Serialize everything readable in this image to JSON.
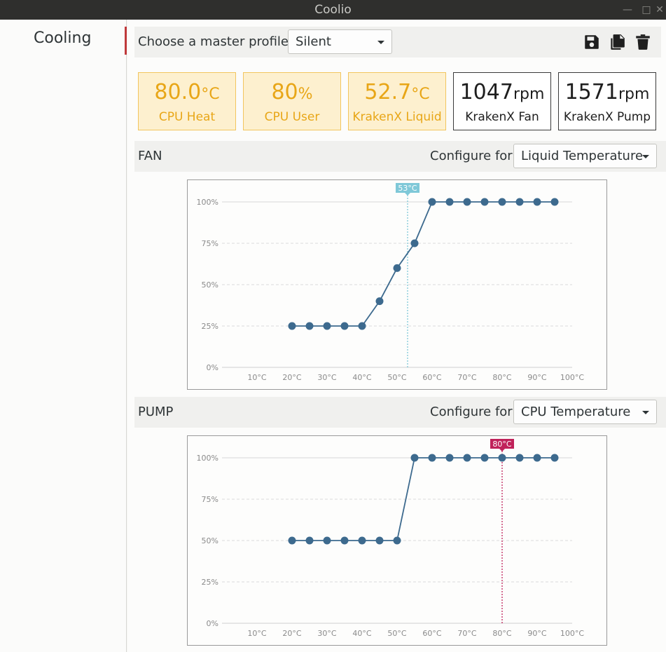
{
  "window": {
    "title": "Coolio"
  },
  "sidebar": {
    "items": [
      {
        "label": "Cooling",
        "selected": true
      }
    ]
  },
  "profile": {
    "label": "Choose a master profile:",
    "selected": "Silent",
    "tools": [
      "save-icon",
      "copy-icon",
      "delete-icon"
    ]
  },
  "cards": [
    {
      "value": "80.0",
      "unit": "°C",
      "label": "CPU Heat",
      "style": "warm"
    },
    {
      "value": "80",
      "unit": "%",
      "label": "CPU User",
      "style": "warm"
    },
    {
      "value": "52.7",
      "unit": "°C",
      "label": "KrakenX Liquid",
      "style": "warm"
    },
    {
      "value": "1047",
      "unit": "rpm",
      "label": "KrakenX Fan",
      "style": "plain"
    },
    {
      "value": "1571",
      "unit": "rpm",
      "label": "KrakenX Pump",
      "style": "plain"
    }
  ],
  "sections": [
    {
      "title": "FAN",
      "configure_label": "Configure for:",
      "configure_value": "Liquid Temperature"
    },
    {
      "title": "PUMP",
      "configure_label": "Configure for:",
      "configure_value": "CPU Temperature"
    }
  ],
  "colors": {
    "accent_warm": "#e8a617",
    "line": "#3d6a8e",
    "fan_marker": "#7fc8d8",
    "pump_marker": "#c0225a",
    "sidebar_selection": "#c0393b"
  },
  "chart_data": [
    {
      "type": "line",
      "x": [
        20,
        25,
        30,
        35,
        40,
        45,
        50,
        55,
        60,
        65,
        70,
        75,
        80,
        85,
        90,
        95
      ],
      "series": [
        {
          "values": [
            25,
            25,
            25,
            25,
            25,
            40,
            60,
            75,
            100,
            100,
            100,
            100,
            100,
            100,
            100,
            100
          ]
        }
      ],
      "xlim": [
        0,
        100
      ],
      "ylim": [
        0,
        100
      ],
      "x_ticks": [
        "10°C",
        "20°C",
        "30°C",
        "40°C",
        "50°C",
        "60°C",
        "70°C",
        "80°C",
        "90°C",
        "100°C"
      ],
      "y_ticks": [
        "0%",
        "25%",
        "50%",
        "75%",
        "100%"
      ],
      "marker": {
        "x": 53,
        "label": "53°C"
      },
      "grid": true
    },
    {
      "type": "line",
      "x": [
        20,
        25,
        30,
        35,
        40,
        45,
        50,
        55,
        60,
        65,
        70,
        75,
        80,
        85,
        90,
        95
      ],
      "series": [
        {
          "values": [
            50,
            50,
            50,
            50,
            50,
            50,
            50,
            100,
            100,
            100,
            100,
            100,
            100,
            100,
            100,
            100
          ]
        }
      ],
      "xlim": [
        0,
        100
      ],
      "ylim": [
        0,
        100
      ],
      "x_ticks": [
        "10°C",
        "20°C",
        "30°C",
        "40°C",
        "50°C",
        "60°C",
        "70°C",
        "80°C",
        "90°C",
        "100°C"
      ],
      "y_ticks": [
        "0%",
        "25%",
        "50%",
        "75%",
        "100%"
      ],
      "marker": {
        "x": 80,
        "label": "80°C"
      },
      "grid": true
    }
  ]
}
